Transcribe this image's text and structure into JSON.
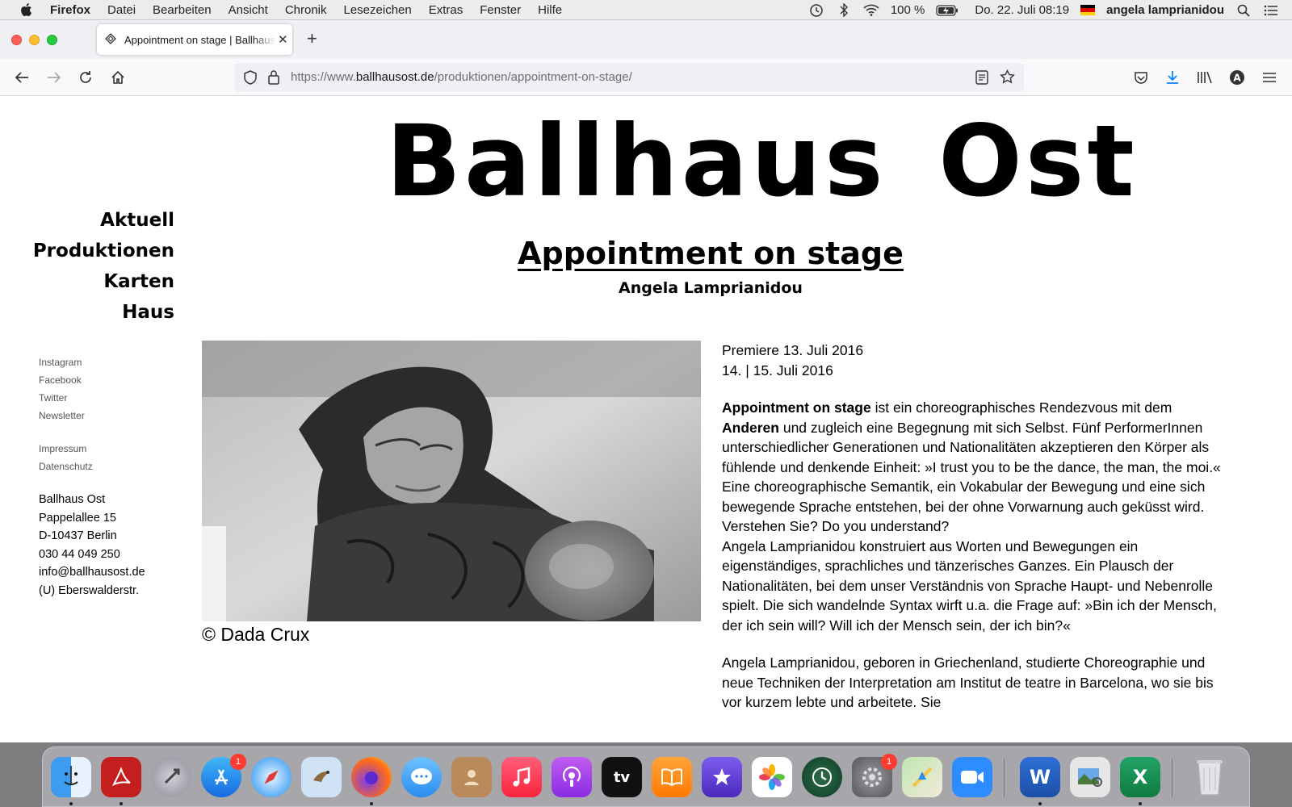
{
  "menubar": {
    "app_name": "Firefox",
    "items": [
      "Datei",
      "Bearbeiten",
      "Ansicht",
      "Chronik",
      "Lesezeichen",
      "Extras",
      "Fenster",
      "Hilfe"
    ],
    "battery": "100 %",
    "datetime": "Do. 22. Juli  08:19",
    "user": "angela lamprianidou"
  },
  "browser": {
    "tab_title": "Appointment on stage | Ballhaus Ost",
    "url_prefix": "https://www.",
    "url_host": "ballhausost.de",
    "url_path": "/produktionen/appointment-on-stage/"
  },
  "site": {
    "title": "Ballhaus Ost",
    "nav": [
      "Aktuell",
      "Produktionen",
      "Karten",
      "Haus"
    ],
    "social": [
      "Instagram",
      "Facebook",
      "Twitter",
      "Newsletter"
    ],
    "legal": [
      "Impressum",
      "Datenschutz"
    ],
    "address": [
      "Ballhaus Ost",
      "Pappelallee 15",
      "D-10437 Berlin",
      "030 44 049 250",
      "info@ballhausost.de",
      "(U) Eberswalderstr."
    ]
  },
  "production": {
    "title": "Appointment on stage",
    "artist": "Angela Lamprianidou",
    "photo_credit": "© Dada Crux",
    "dates": [
      "Premiere 13. Juli 2016",
      "14. | 15. Juli 2016"
    ],
    "intro_bold": "Appointment on stage",
    "intro_rest_1": " ist ein choreographisches Rendezvous mit dem ",
    "intro_bold_2": "Anderen",
    "intro_rest_2": " und zugleich eine Begegnung mit sich Selbst. Fünf PerformerInnen unterschiedlicher Generationen und Nationalitäten akzeptieren den Körper als fühlende und denkende Einheit: »I trust you to be the dance, the man, the moi.«",
    "paragraph_2": "Eine choreographische Semantik, ein Vokabular der Bewegung und eine sich bewegende Sprache entstehen, bei der ohne Vorwarnung auch geküsst wird. Verstehen Sie? Do you understand?",
    "paragraph_3": "Angela Lamprianidou konstruiert aus Worten und Bewegungen ein eigenständiges, sprachliches und tänzerisches Ganzes. Ein Plausch der Nationalitäten, bei dem unser Verständnis von Sprache Haupt- und Nebenrolle spielt. Die sich wandelnde Syntax wirft u.a. die Frage auf: »Bin ich der Mensch, der ich sein will? Will ich der Mensch sein, der ich bin?«",
    "paragraph_4": "Angela Lamprianidou, geboren in Griechenland, studierte Choreographie und neue Techniken der Interpretation am Institut de teatre in Barcelona, wo sie bis vor kurzem lebte und arbeitete. Sie"
  },
  "dock": {
    "icons": [
      "finder-icon",
      "acrobat-icon",
      "launchpad-icon",
      "app-store-icon",
      "safari-icon",
      "mail-icon",
      "firefox-icon",
      "messages-icon",
      "contacts-icon",
      "music-icon",
      "podcasts-icon",
      "apple-tv-icon",
      "books-icon",
      "imovie-icon",
      "photos-icon",
      "time-machine-icon",
      "system-preferences-icon",
      "maps-icon",
      "zoom-icon",
      "word-icon",
      "preview-icon",
      "excel-icon",
      "trash-icon"
    ],
    "badges": {
      "app_store": "1",
      "system_preferences": "1"
    },
    "tv_label": "tv",
    "word_label": "W",
    "excel_label": "X"
  },
  "colors": {
    "page_bg": "#ffffff",
    "text": "#000000",
    "chrome_bg": "#f0f0f4",
    "url_host": "#15141a",
    "url_muted": "#6d6d70",
    "firefox_download_blue": "#0a84ff"
  }
}
